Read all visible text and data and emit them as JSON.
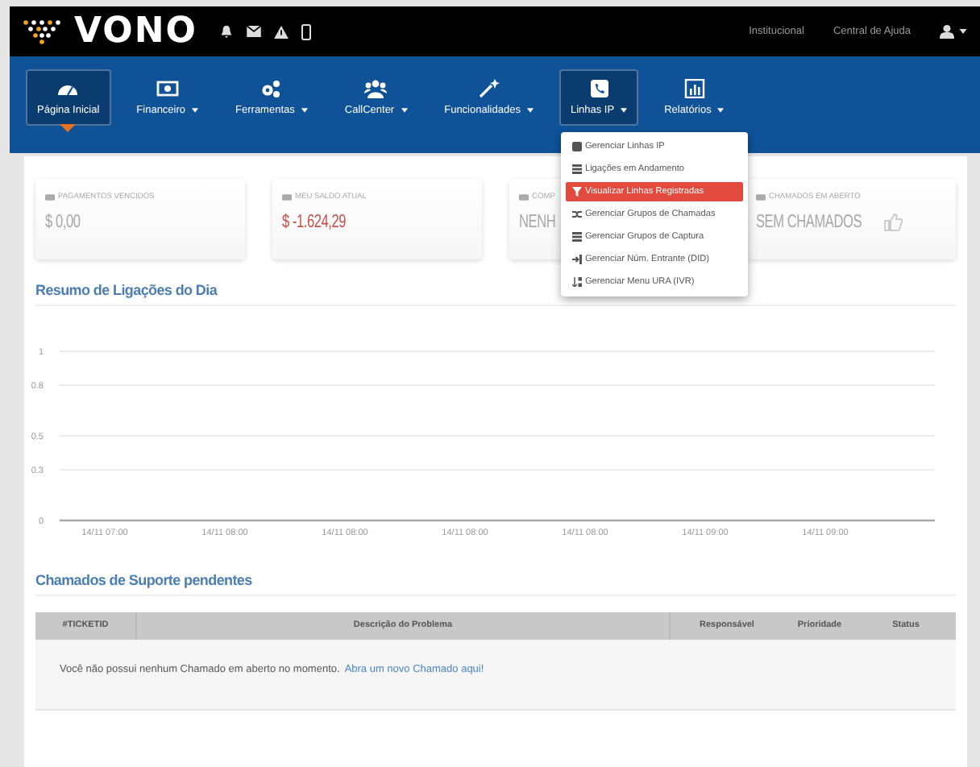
{
  "topbar": {
    "logo": "VONO",
    "links": [
      "Institucional",
      "Central de Ajuda"
    ]
  },
  "nav": [
    {
      "label": "Página Inicial",
      "dropdown": false,
      "selected": true
    },
    {
      "label": "Financeiro",
      "dropdown": true,
      "selected": false
    },
    {
      "label": "Ferramentas",
      "dropdown": true,
      "selected": false
    },
    {
      "label": "CallCenter",
      "dropdown": true,
      "selected": false
    },
    {
      "label": "Funcionalidades",
      "dropdown": true,
      "selected": false
    },
    {
      "label": "Linhas IP",
      "dropdown": true,
      "selected": false,
      "open": true
    },
    {
      "label": "Relatórios",
      "dropdown": true,
      "selected": false
    }
  ],
  "menu": [
    {
      "label": "Gerenciar Linhas IP",
      "selected": false
    },
    {
      "label": "Ligações em Andamento",
      "selected": false
    },
    {
      "label": "Visualizar Linhas Registradas",
      "selected": true
    },
    {
      "label": "Gerenciar Grupos de Chamadas",
      "selected": false
    },
    {
      "label": "Gerenciar Grupos de Captura",
      "selected": false
    },
    {
      "label": "Gerenciar Núm. Entrante (DID)",
      "selected": false
    },
    {
      "label": "Gerenciar Menu URA (IVR)",
      "selected": false
    }
  ],
  "cards": [
    {
      "label": "PAGAMENTOS VENCIDOS",
      "value": "$ 0,00",
      "negative": false
    },
    {
      "label": "MEU SALDO ATUAL",
      "value": "$ -1.624,29",
      "negative": true
    },
    {
      "label": "COMP",
      "value": "NENH",
      "negative": false
    },
    {
      "label": "CHAMADOS EM ABERTO",
      "value": "SEM CHAMADOS",
      "negative": false
    }
  ],
  "summary": {
    "title": "Resumo de Ligações do Dia",
    "chart_data": {
      "type": "line",
      "grid": true,
      "categories": [
        "14/11 07:00",
        "14/11 08:00",
        "14/11 08:00",
        "14/11 08:00",
        "14/11 08:00",
        "14/11 09:00",
        "14/11 09:00"
      ],
      "yticks": [
        0,
        0.3,
        0.5,
        0.8,
        1
      ],
      "ylim": [
        0,
        1
      ]
    }
  },
  "tickets": {
    "title": "Chamados de Suporte pendentes",
    "columns": [
      "#TICKETID",
      "Descrição do Problema",
      "Responsável",
      "Prioridade",
      "Status"
    ],
    "empty_text": "Você não possui nenhum Chamado em aberto no momento.",
    "link": "Abra um novo Chamado aqui!"
  }
}
